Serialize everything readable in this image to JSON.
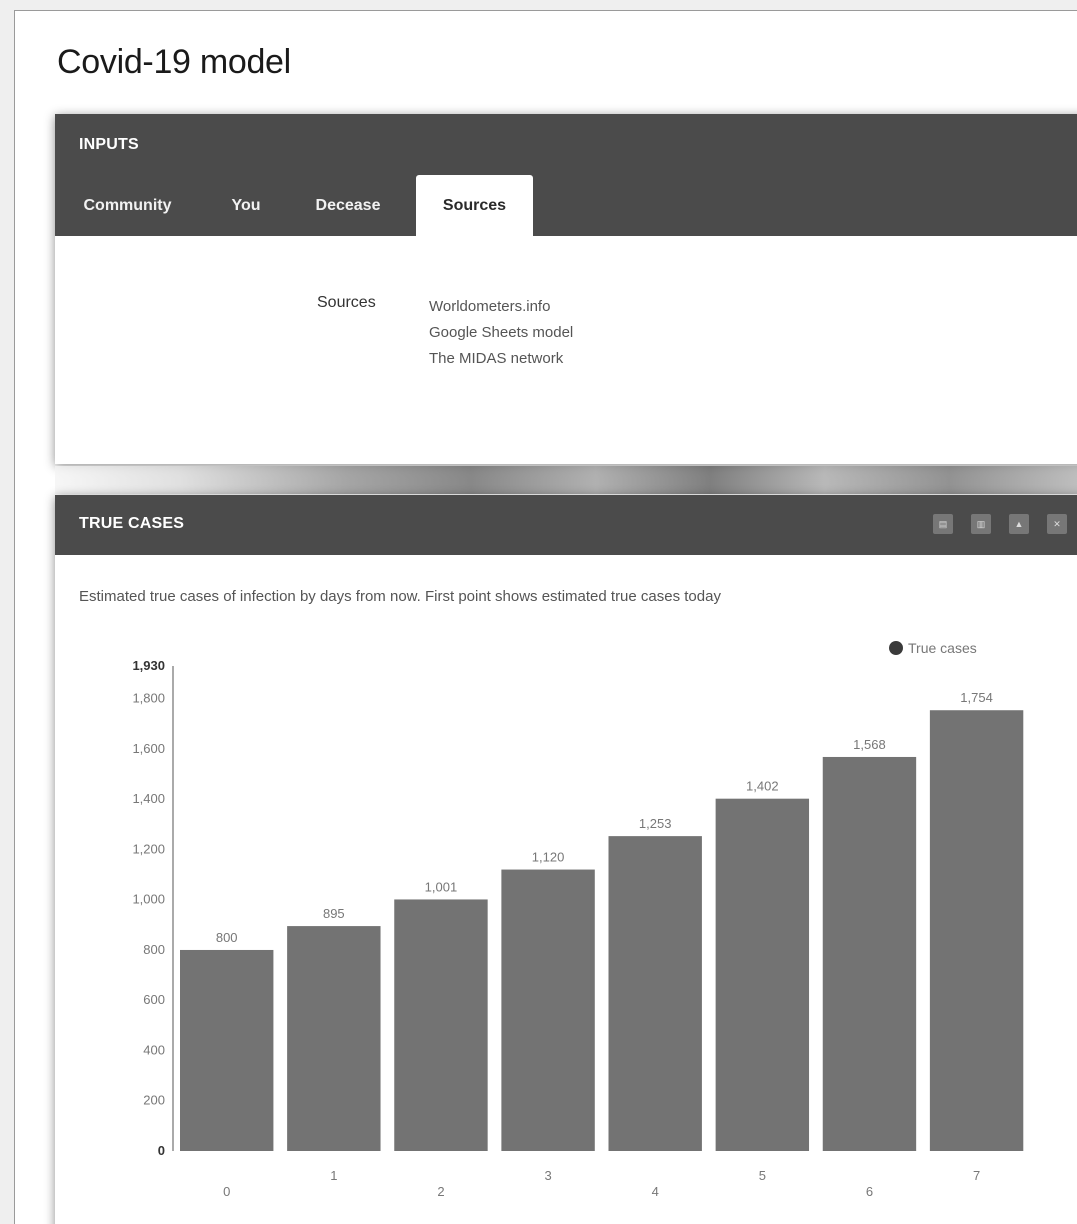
{
  "page": {
    "title": "Covid-19 model"
  },
  "inputs": {
    "header": "INPUTS",
    "tabs": [
      {
        "label": "Community",
        "active": false
      },
      {
        "label": "You",
        "active": false
      },
      {
        "label": "Decease",
        "active": false
      },
      {
        "label": "Sources",
        "active": true
      }
    ],
    "sources_label": "Sources",
    "sources": [
      "Worldometers.info",
      "Google Sheets model",
      "The MIDAS network"
    ]
  },
  "true_cases": {
    "header": "TRUE CASES",
    "description": "Estimated true cases of infection by days from now. First point shows estimated true cases today",
    "header_icons": [
      "t-icon",
      "p-icon",
      "a-icon",
      "e-icon"
    ]
  },
  "chart_data": {
    "type": "bar",
    "categories": [
      "0",
      "1",
      "2",
      "3",
      "4",
      "5",
      "6",
      "7"
    ],
    "series": [
      {
        "name": "True cases",
        "values": [
          800,
          895,
          1001,
          1120,
          1253,
          1402,
          1568,
          1754
        ]
      }
    ],
    "data_labels": [
      "800",
      "895",
      "1,001",
      "1,120",
      "1,253",
      "1,402",
      "1,568",
      "1,754"
    ],
    "ylim": [
      0,
      1930
    ],
    "yticks": [
      0,
      200,
      400,
      600,
      800,
      1000,
      1200,
      1400,
      1600,
      1800,
      1930
    ],
    "ytick_labels": [
      "0",
      "200",
      "400",
      "600",
      "800",
      "1,000",
      "1,200",
      "1,400",
      "1,600",
      "1,800",
      "1,930"
    ],
    "legend_position": "top-right",
    "bar_color": "#737373",
    "legend_marker_color": "#3a3a3a"
  }
}
